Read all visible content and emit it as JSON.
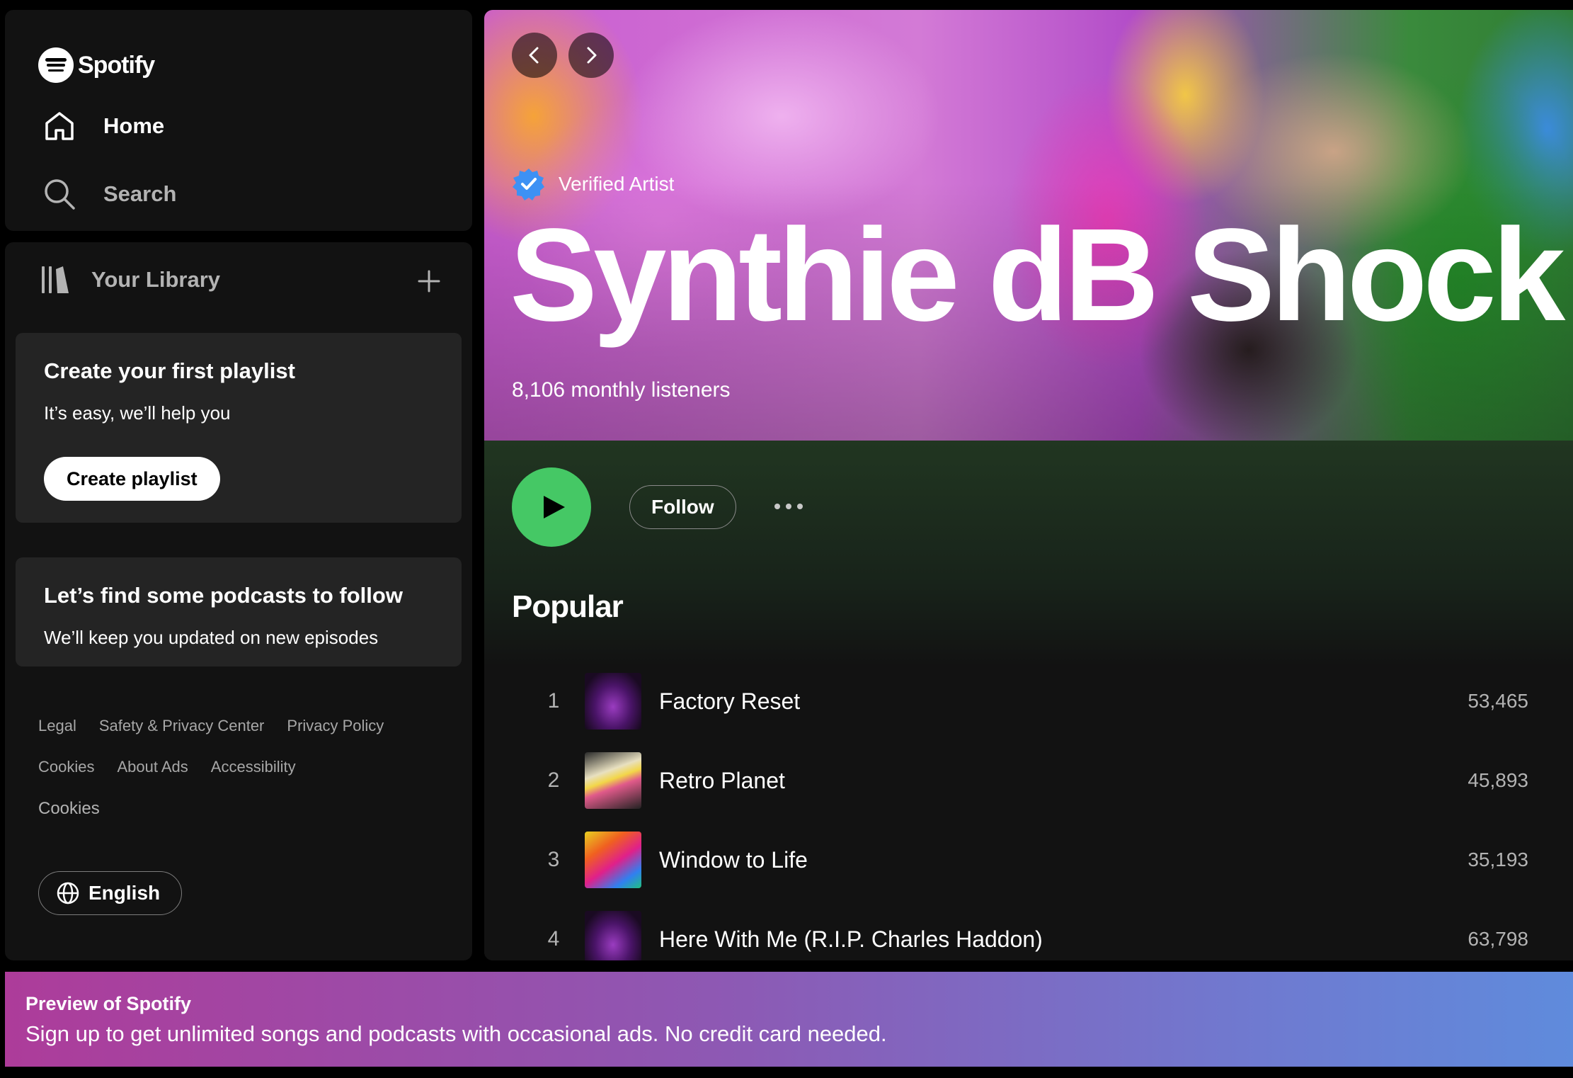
{
  "brand": {
    "name": "Spotify"
  },
  "nav": {
    "home_label": "Home",
    "search_label": "Search"
  },
  "library": {
    "title": "Your Library",
    "playlist_card": {
      "title": "Create your first playlist",
      "subtitle": "It’s easy, we’ll help you",
      "button_label": "Create playlist"
    },
    "podcast_card": {
      "title": "Let’s find some podcasts to follow",
      "subtitle": "We’ll keep you updated on new episodes"
    }
  },
  "footer": {
    "links_row1": [
      "Legal",
      "Safety & Privacy Center",
      "Privacy Policy"
    ],
    "links_row2": [
      "Cookies",
      "About Ads",
      "Accessibility"
    ],
    "cookies_link": "Cookies",
    "language_label": "English"
  },
  "artist": {
    "verified_label": "Verified Artist",
    "name": "Synthie dB Shock",
    "listeners": "8,106 monthly listeners",
    "follow_label": "Follow"
  },
  "popular": {
    "title": "Popular",
    "tracks": [
      {
        "rank": "1",
        "title": "Factory Reset",
        "plays": "53,465"
      },
      {
        "rank": "2",
        "title": "Retro Planet",
        "plays": "45,893"
      },
      {
        "rank": "3",
        "title": "Window to Life",
        "plays": "35,193"
      },
      {
        "rank": "4",
        "title": "Here With Me (R.I.P. Charles Haddon)",
        "plays": "63,798"
      }
    ]
  },
  "banner": {
    "title": "Preview of Spotify",
    "text": "Sign up to get unlimited songs and podcasts with occasional ads. No credit card needed."
  },
  "colors": {
    "accent": "#45c865",
    "background": "#121212",
    "verified": "#3d91f4"
  },
  "icons": [
    "spotify-logo-icon",
    "home-icon",
    "search-icon",
    "library-icon",
    "plus-icon",
    "globe-icon",
    "chevron-left-icon",
    "chevron-right-icon",
    "verified-badge-icon",
    "play-icon",
    "more-icon"
  ]
}
